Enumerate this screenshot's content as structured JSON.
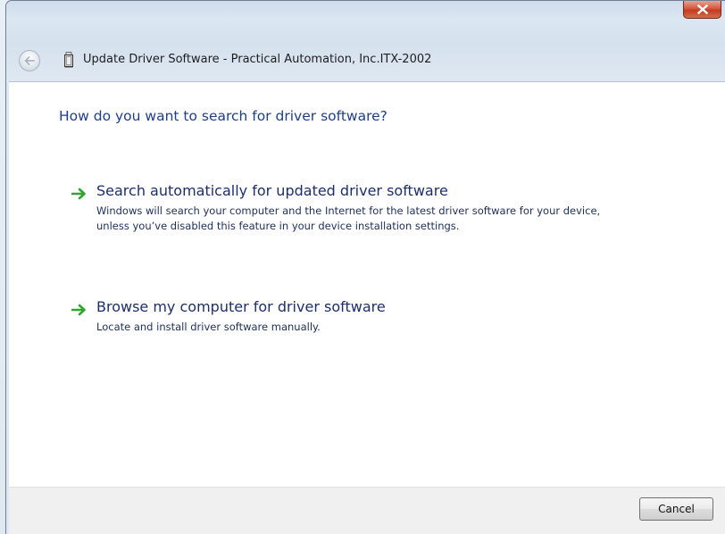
{
  "dialog": {
    "title": "Update Driver Software - Practical Automation, Inc.ITX-2002",
    "close_symbol": "X",
    "back_icon": "back-arrow-icon",
    "device_icon": "printer-device-icon"
  },
  "content": {
    "heading": "How do you want to search for driver software?",
    "options": [
      {
        "icon": "green-arrow-icon",
        "title": "Search automatically for updated driver software",
        "description": "Windows will search your computer and the Internet for the latest driver software for your device, unless you’ve disabled this feature in your device installation settings."
      },
      {
        "icon": "green-arrow-icon",
        "title": "Browse my computer for driver software",
        "description": "Locate and install driver software manually."
      }
    ]
  },
  "footer": {
    "cancel_label": "Cancel"
  },
  "colors": {
    "heading": "#1f3e8a",
    "arrow": "#2ea82e",
    "close_button": "#c43b1f"
  }
}
